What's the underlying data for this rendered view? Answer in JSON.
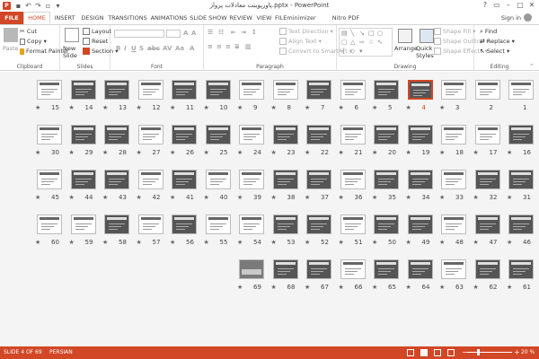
{
  "window": {
    "title": "پاورپوینت معادلات پرواز.pptx - PowerPoint",
    "sign_in": "Sign in",
    "app_icon": "P"
  },
  "tabs": [
    {
      "label": "FILE"
    },
    {
      "label": "HOME"
    },
    {
      "label": "INSERT"
    },
    {
      "label": "DESIGN"
    },
    {
      "label": "TRANSITIONS"
    },
    {
      "label": "ANIMATIONS"
    },
    {
      "label": "SLIDE SHOW"
    },
    {
      "label": "REVIEW"
    },
    {
      "label": "VIEW"
    },
    {
      "label": "FILEminimizer"
    },
    {
      "label": "Nitro PDF Professional"
    }
  ],
  "ribbon": {
    "clipboard": {
      "label": "Clipboard",
      "paste": "Paste",
      "cut": "Cut",
      "copy": "Copy",
      "format_painter": "Format Painter"
    },
    "slides": {
      "label": "Slides",
      "new_slide": "New Slide",
      "layout": "Layout",
      "reset": "Reset",
      "section": "Section"
    },
    "font": {
      "label": "Font"
    },
    "paragraph": {
      "label": "Paragraph",
      "text_direction": "Text Direction",
      "align_text": "Align Text",
      "convert_smartart": "Convert to SmartArt"
    },
    "drawing": {
      "label": "Drawing",
      "arrange": "Arrange",
      "quick_styles": "Quick Styles",
      "shape_fill": "Shape Fill",
      "shape_outline": "Shape Outline",
      "shape_effects": "Shape Effects"
    },
    "editing": {
      "label": "Editing",
      "find": "Find",
      "replace": "Replace",
      "select": "Select"
    }
  },
  "sorter": {
    "star_glyph": "★",
    "rows": [
      [
        1,
        2,
        3,
        4,
        5,
        6,
        7,
        8,
        9,
        10,
        11,
        12,
        13,
        14,
        15
      ],
      [
        16,
        17,
        18,
        19,
        20,
        21,
        22,
        23,
        24,
        25,
        26,
        27,
        28,
        29,
        30
      ],
      [
        31,
        32,
        33,
        34,
        35,
        36,
        37,
        38,
        39,
        40,
        41,
        42,
        43,
        44,
        45
      ],
      [
        46,
        47,
        48,
        49,
        50,
        51,
        52,
        53,
        54,
        55,
        56,
        57,
        58,
        59,
        60
      ],
      [
        61,
        62,
        63,
        64,
        65,
        66,
        67,
        68,
        69
      ]
    ],
    "selected": 4,
    "no_star": [
      1,
      2
    ]
  },
  "status": {
    "slide": "SLIDE 4 OF 69",
    "language": "PERSIAN",
    "zoom": "20 %",
    "zoom_minus": "−",
    "zoom_plus": "+"
  },
  "colors": {
    "accent": "#d24726"
  }
}
